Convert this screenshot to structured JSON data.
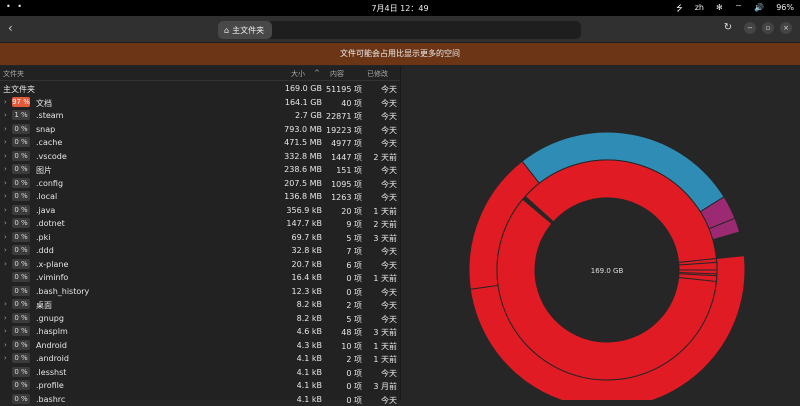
{
  "topbar": {
    "dots": "• •",
    "clock": "7月4日 12：49",
    "right": [
      "⭍",
      "zh",
      "✻",
      "⌔",
      "🔊",
      "96%"
    ]
  },
  "header": {
    "back_icon": "‹",
    "breadcrumb": "主文件夹",
    "home_icon": "⌂",
    "buttons": [
      "↻",
      "−",
      "▫",
      "×"
    ]
  },
  "banner": {
    "text": "文件可能会占用比显示更多的空间"
  },
  "columns": {
    "name": "文件夹",
    "size": "大小",
    "sort_icon": "^",
    "contents": "内容",
    "modified": "已修改"
  },
  "rows": [
    {
      "chev": "",
      "pct": "",
      "name": "主文件夹",
      "size": "169.0 GB",
      "count": "51195 项",
      "mod": "今天"
    },
    {
      "chev": "›",
      "pct": "97 %",
      "name": "文档",
      "size": "164.1 GB",
      "count": "40 项",
      "mod": "今天"
    },
    {
      "chev": "›",
      "pct": "1 %",
      "name": ".steam",
      "size": "2.7 GB",
      "count": "22871 项",
      "mod": "今天"
    },
    {
      "chev": "›",
      "pct": "0 %",
      "name": "snap",
      "size": "793.0 MB",
      "count": "19223 项",
      "mod": "今天"
    },
    {
      "chev": "›",
      "pct": "0 %",
      "name": ".cache",
      "size": "471.5 MB",
      "count": "4977 项",
      "mod": "今天"
    },
    {
      "chev": "›",
      "pct": "0 %",
      "name": ".vscode",
      "size": "332.8 MB",
      "count": "1447 项",
      "mod": "2 天前"
    },
    {
      "chev": "›",
      "pct": "0 %",
      "name": "图片",
      "size": "238.6 MB",
      "count": "151 项",
      "mod": "今天"
    },
    {
      "chev": "›",
      "pct": "0 %",
      "name": ".config",
      "size": "207.5 MB",
      "count": "1095 项",
      "mod": "今天"
    },
    {
      "chev": "›",
      "pct": "0 %",
      "name": ".local",
      "size": "136.8 MB",
      "count": "1263 项",
      "mod": "今天"
    },
    {
      "chev": "›",
      "pct": "0 %",
      "name": ".java",
      "size": "356.9 kB",
      "count": "20 项",
      "mod": "1 天前"
    },
    {
      "chev": "›",
      "pct": "0 %",
      "name": ".dotnet",
      "size": "147.7 kB",
      "count": "9 项",
      "mod": "2 天前"
    },
    {
      "chev": "›",
      "pct": "0 %",
      "name": ".pki",
      "size": "69.7 kB",
      "count": "5 项",
      "mod": "3 天前"
    },
    {
      "chev": "›",
      "pct": "0 %",
      "name": ".ddd",
      "size": "32.8 kB",
      "count": "7 项",
      "mod": "今天"
    },
    {
      "chev": "›",
      "pct": "0 %",
      "name": ".x-plane",
      "size": "20.7 kB",
      "count": "6 项",
      "mod": "今天"
    },
    {
      "chev": "",
      "pct": "0 %",
      "name": ".viminfo",
      "size": "16.4 kB",
      "count": "0 项",
      "mod": "1 天前"
    },
    {
      "chev": "",
      "pct": "0 %",
      "name": ".bash_history",
      "size": "12.3 kB",
      "count": "0 项",
      "mod": "今天"
    },
    {
      "chev": "›",
      "pct": "0 %",
      "name": "桌面",
      "size": "8.2 kB",
      "count": "2 项",
      "mod": "今天"
    },
    {
      "chev": "›",
      "pct": "0 %",
      "name": ".gnupg",
      "size": "8.2 kB",
      "count": "5 项",
      "mod": "今天"
    },
    {
      "chev": "›",
      "pct": "0 %",
      "name": ".hasplm",
      "size": "4.6 kB",
      "count": "48 项",
      "mod": "3 天前"
    },
    {
      "chev": "›",
      "pct": "0 %",
      "name": "Android",
      "size": "4.3 kB",
      "count": "10 项",
      "mod": "1 天前"
    },
    {
      "chev": "›",
      "pct": "0 %",
      "name": ".android",
      "size": "4.1 kB",
      "count": "2 项",
      "mod": "1 天前"
    },
    {
      "chev": "",
      "pct": "0 %",
      "name": ".lesshst",
      "size": "4.1 kB",
      "count": "0 项",
      "mod": "今天"
    },
    {
      "chev": "",
      "pct": "0 %",
      "name": ".profile",
      "size": "4.1 kB",
      "count": "0 项",
      "mod": "3 月前"
    },
    {
      "chev": "",
      "pct": "0 %",
      "name": ".bashrc",
      "size": "4.1 kB",
      "count": "0 项",
      "mod": "今天"
    }
  ],
  "ring_chart": {
    "center_label": "169.0 GB",
    "colors": {
      "red": "#e01b24",
      "blue": "#2f8cb5",
      "purple": "#9b2a73",
      "accent_badge": "#e55a3b",
      "banner": "#6b3516"
    }
  }
}
